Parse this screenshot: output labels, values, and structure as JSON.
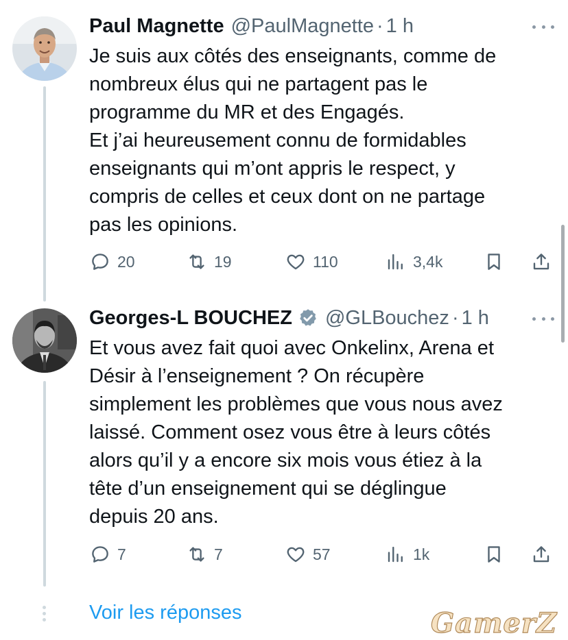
{
  "tweets": [
    {
      "name": "Paul Magnette",
      "handle": "@PaulMagnette",
      "separator": "·",
      "time": "1 h",
      "verified": false,
      "text": [
        "Je suis aux côtés des enseignants, comme de",
        "nombreux élus qui ne partagent pas le",
        "programme du MR et des Engagés.",
        "Et j’ai heureusement connu de formidables",
        "enseignants qui m’ont appris le respect, y",
        "compris de celles et ceux dont on ne partage",
        "pas les opinions."
      ],
      "replies": "20",
      "retweets": "19",
      "likes": "110",
      "views": "3,4k"
    },
    {
      "name": "Georges-L BOUCHEZ",
      "handle": "@GLBouchez",
      "separator": "·",
      "time": "1 h",
      "verified": true,
      "text": [
        "Et vous avez fait quoi avec Onkelinx, Arena et",
        "Désir à l’enseignement ? On récupère",
        "simplement les problèmes que vous nous avez",
        "laissé. Comment osez vous être à leurs côtés",
        "alors qu’il y a encore six mois vous étiez à la",
        "tête d’un enseignement qui se déglingue",
        "depuis 20 ans."
      ],
      "replies": "7",
      "retweets": "7",
      "likes": "57",
      "views": "1k"
    }
  ],
  "show_replies": "Voir les réponses",
  "watermark": "GamerZ",
  "colors": {
    "accent": "#1d9bf0",
    "secondary_text": "#536471",
    "thread_line": "#cfd9de"
  },
  "icons": [
    "reply-icon",
    "retweet-icon",
    "like-icon",
    "views-icon",
    "bookmark-icon",
    "share-icon",
    "more-icon",
    "verified-badge-icon"
  ]
}
